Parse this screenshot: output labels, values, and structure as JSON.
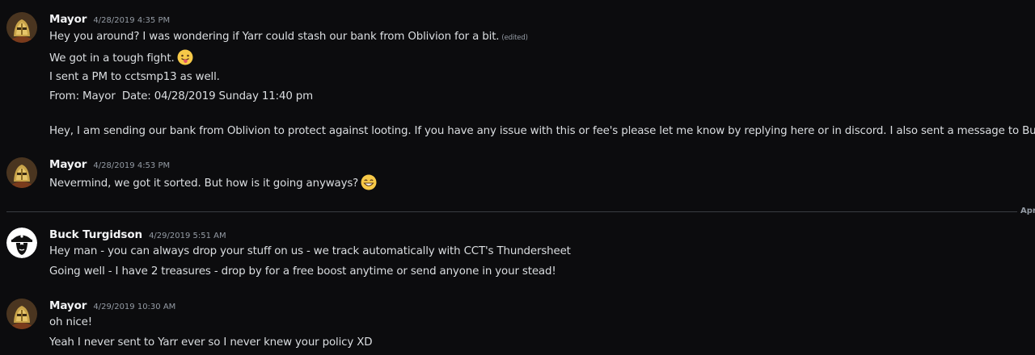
{
  "messages": [
    {
      "author": "Mayor",
      "timestamp": "4/28/2019 4:35 PM",
      "avatar": "knight-helmet-avatar",
      "lines": [
        "Hey you around? I was wondering if Yarr could stash our bank from Oblivion for a bit.",
        "We got in a tough fight.",
        "I sent a PM to cctsmp13 as well.",
        "From: Mayor  Date: 04/28/2019 Sunday 11:40 pm",
        "Hey, I am sending our bank from Oblivion to protect against looting. If you have any issue with this or fee's please let me know by replying here or in discord. I also sent a message to Buck."
      ],
      "edited_label": "(edited)",
      "emoji_1": "tongue-out-emoji"
    },
    {
      "author": "Mayor",
      "timestamp": "4/28/2019 4:53 PM",
      "avatar": "knight-helmet-avatar",
      "lines": [
        "Nevermind, we got it sorted. But how is it going anyways?"
      ],
      "emoji_1": "grinning-smile-emoji"
    },
    {
      "author": "Buck Turgidson",
      "timestamp": "4/29/2019 5:51 AM",
      "avatar": "pirate-bandana-avatar",
      "lines": [
        "Hey man - you can always drop your stuff on us - we track automatically with CCT's Thundersheet",
        "Going well - I have 2 treasures - drop by for a free boost anytime or send anyone in your stead!"
      ]
    },
    {
      "author": "Mayor",
      "timestamp": "4/29/2019 10:30 AM",
      "avatar": "knight-helmet-avatar",
      "lines": [
        "oh nice!",
        "Yeah I never sent to Yarr ever so I never knew your policy XD"
      ]
    }
  ],
  "date_divider": {
    "label": "Apr"
  },
  "colors": {
    "background": "#0c0c0e",
    "text": "#dbdee1",
    "author": "#f2f3f5",
    "muted": "#949ba4",
    "divider": "#3a3c42"
  }
}
